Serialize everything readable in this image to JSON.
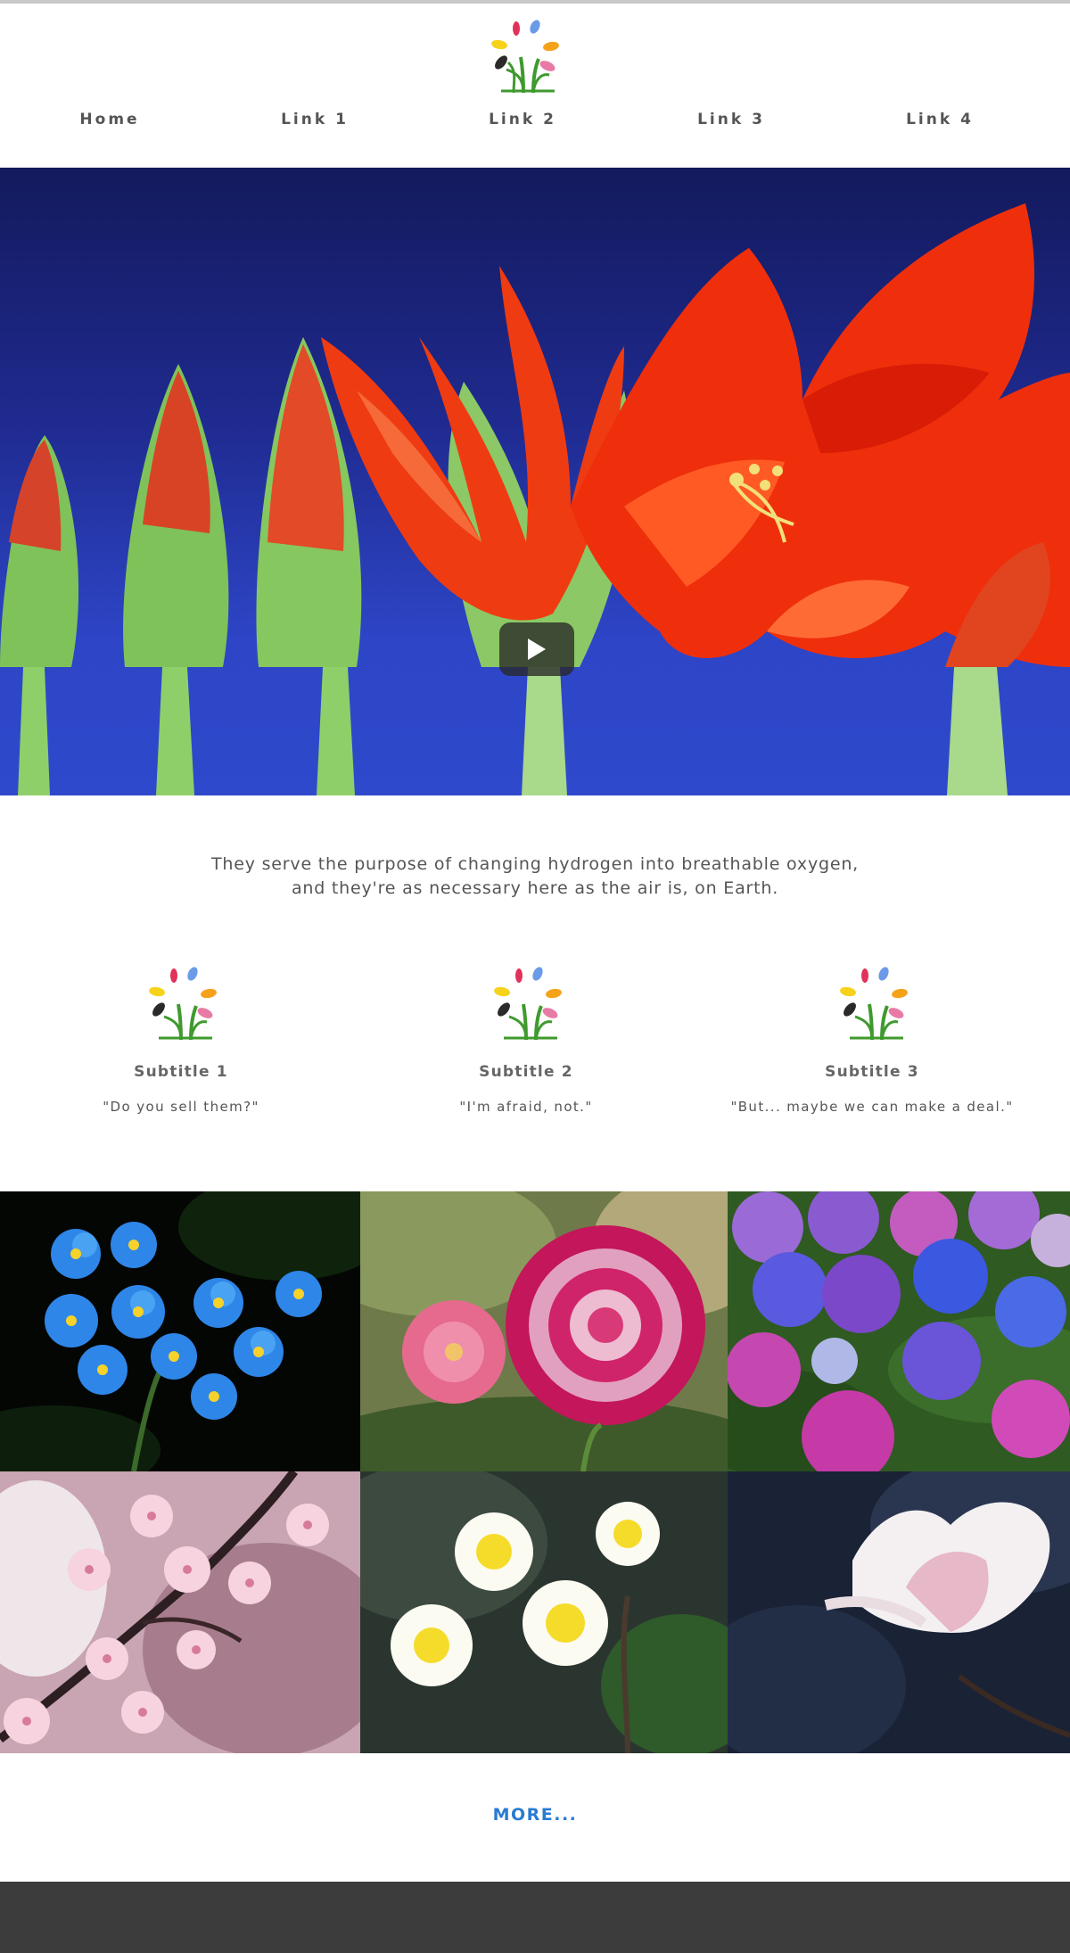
{
  "brand": {
    "logo_icon": "flower-logo-icon"
  },
  "nav": {
    "items": [
      {
        "label": "Home"
      },
      {
        "label": "Link 1"
      },
      {
        "label": "Link 2"
      },
      {
        "label": "Link 3"
      },
      {
        "label": "Link 4"
      }
    ]
  },
  "hero": {
    "play_icon": "play-icon"
  },
  "intro": {
    "line1": "They serve the purpose of changing hydrogen into breathable oxygen,",
    "line2": "and they're as necessary here as the air is, on Earth."
  },
  "features": [
    {
      "subtitle": "Subtitle 1",
      "quote": "\"Do you sell them?\""
    },
    {
      "subtitle": "Subtitle 2",
      "quote": "\"I'm afraid, not.\""
    },
    {
      "subtitle": "Subtitle 3",
      "quote": "\"But... maybe we can make a deal.\""
    }
  ],
  "gallery": {
    "images": [
      {
        "name": "forget-me-not"
      },
      {
        "name": "dahlia"
      },
      {
        "name": "hydrangea"
      },
      {
        "name": "cherry-blossom"
      },
      {
        "name": "plumeria"
      },
      {
        "name": "magnolia"
      }
    ]
  },
  "more": {
    "label": "MORE..."
  },
  "colors": {
    "link": "#2a7bd1",
    "footer": "#3c3c3c",
    "hero_sky_top": "#131a5c",
    "hero_sky_bottom": "#2f49cc"
  }
}
